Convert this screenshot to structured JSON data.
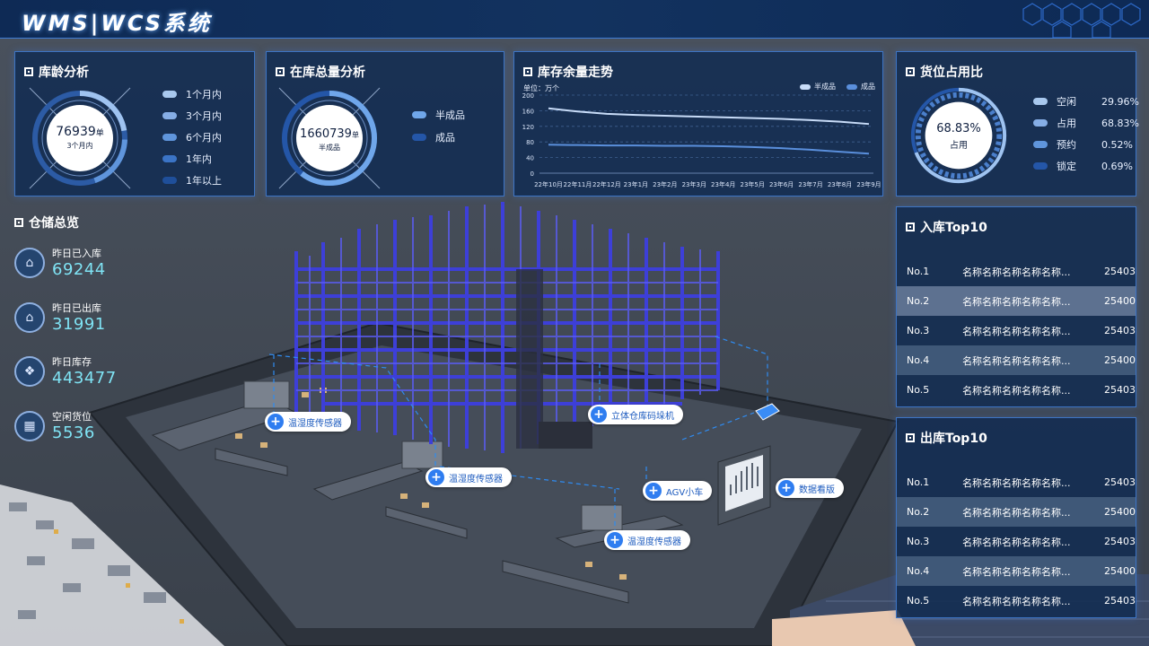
{
  "header": {
    "title": "WMS|WCS系统"
  },
  "age_panel": {
    "title": "库龄分析",
    "center_value": "76939",
    "center_unit": "单",
    "center_label": "3个月内",
    "legend": [
      {
        "label": "1个月内",
        "color": "#a8c8ee"
      },
      {
        "label": "3个月内",
        "color": "#86aee6"
      },
      {
        "label": "6个月内",
        "color": "#5f95dc"
      },
      {
        "label": "1年内",
        "color": "#3b74c6"
      },
      {
        "label": "1年以上",
        "color": "#1f4f9a"
      }
    ]
  },
  "stock_panel": {
    "title": "在库总量分析",
    "center_value": "1660739",
    "center_unit": "单",
    "center_label": "半成品",
    "legend": [
      {
        "label": "半成品",
        "color": "#6fa6ea"
      },
      {
        "label": "成品",
        "color": "#2456a8"
      }
    ]
  },
  "trend_panel": {
    "title": "库存余量走势",
    "unit_label": "单位：万个",
    "legend": [
      {
        "label": "半成品",
        "color": "#c8dcf8"
      },
      {
        "label": "成品",
        "color": "#5a8fdc"
      }
    ]
  },
  "chart_data": {
    "type": "line",
    "categories": [
      "22年10月",
      "22年11月",
      "22年12月",
      "23年1月",
      "23年2月",
      "23年3月",
      "23年4月",
      "23年5月",
      "23年6月",
      "23年7月",
      "23年8月",
      "23年9月"
    ],
    "series": [
      {
        "name": "半成品",
        "values": [
          166,
          158,
          152,
          149,
          147,
          145,
          143,
          141,
          139,
          136,
          132,
          126
        ],
        "color": "#c8dcf8"
      },
      {
        "name": "成品",
        "values": [
          73,
          72,
          71,
          71,
          70,
          70,
          69,
          67,
          64,
          60,
          55,
          50
        ],
        "color": "#5a8fdc"
      }
    ],
    "yticks": [
      0,
      40,
      80,
      120,
      160,
      200
    ],
    "ylim": [
      0,
      200
    ]
  },
  "occupancy_panel": {
    "title": "货位占用比",
    "center_value": "68.83%",
    "center_label": "占用",
    "legend": [
      {
        "label": "空闲",
        "value": "29.96%",
        "color": "#a8c8ee"
      },
      {
        "label": "占用",
        "value": "68.83%",
        "color": "#86aee6"
      },
      {
        "label": "预约",
        "value": "0.52%",
        "color": "#5f95dc"
      },
      {
        "label": "锁定",
        "value": "0.69%",
        "color": "#2456a8"
      }
    ]
  },
  "overview": {
    "title": "仓储总览",
    "items": [
      {
        "label": "昨日已入库",
        "value": "69244",
        "icon": "inbound-icon"
      },
      {
        "label": "昨日已出库",
        "value": "31991",
        "icon": "outbound-icon"
      },
      {
        "label": "昨日库存",
        "value": "443477",
        "icon": "stock-icon"
      },
      {
        "label": "空闲货位",
        "value": "5536",
        "icon": "free-slot-icon"
      }
    ]
  },
  "inbound_top": {
    "title": "入库Top10",
    "rows": [
      {
        "no": "No.1",
        "name": "名称名称名称名称名称...",
        "value": "25403"
      },
      {
        "no": "No.2",
        "name": "名称名称名称名称名称...",
        "value": "25400"
      },
      {
        "no": "No.3",
        "name": "名称名称名称名称名称...",
        "value": "25403"
      },
      {
        "no": "No.4",
        "name": "名称名称名称名称名称...",
        "value": "25400"
      },
      {
        "no": "No.5",
        "name": "名称名称名称名称名称...",
        "value": "25403"
      }
    ]
  },
  "outbound_top": {
    "title": "出库Top10",
    "rows": [
      {
        "no": "No.1",
        "name": "名称名称名称名称名称...",
        "value": "25403"
      },
      {
        "no": "No.2",
        "name": "名称名称名称名称名称...",
        "value": "25400"
      },
      {
        "no": "No.3",
        "name": "名称名称名称名称名称...",
        "value": "25403"
      },
      {
        "no": "No.4",
        "name": "名称名称名称名称名称...",
        "value": "25400"
      },
      {
        "no": "No.5",
        "name": "名称名称名称名称名称...",
        "value": "25403"
      }
    ]
  },
  "scene_tags": [
    {
      "label": "温湿度传感器"
    },
    {
      "label": "立体仓库码垛机"
    },
    {
      "label": "温湿度传感器"
    },
    {
      "label": "AGV小车"
    },
    {
      "label": "数据看版"
    },
    {
      "label": "温湿度传感器"
    }
  ]
}
